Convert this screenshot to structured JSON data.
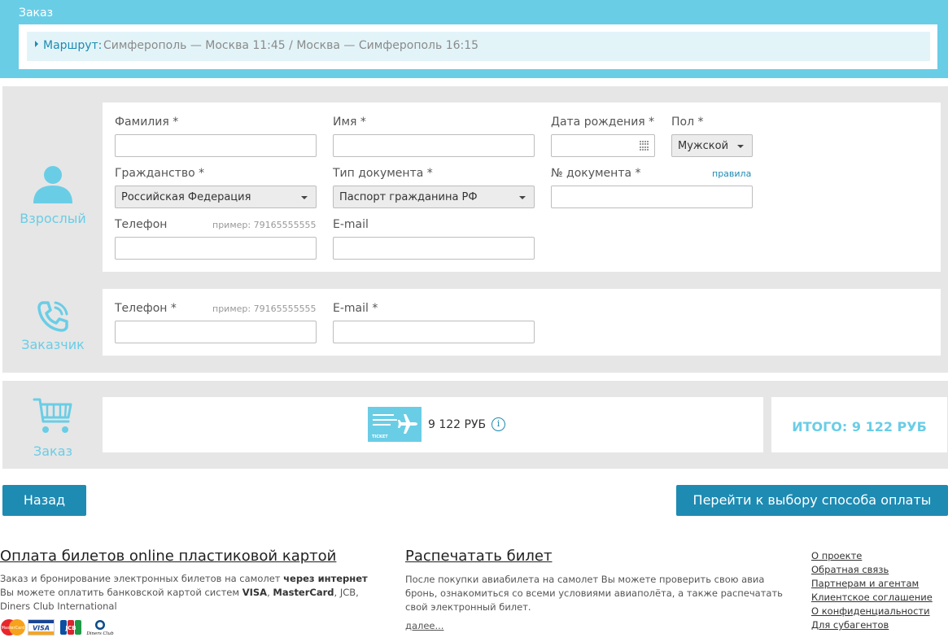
{
  "order_header": {
    "title": "Заказ",
    "route_label": "Маршрут:",
    "route_value": "Симферополь — Москва 11:45 / Москва — Симферополь 16:15"
  },
  "adult": {
    "side_label": "Взрослый",
    "fields": {
      "last_name": {
        "label": "Фамилия *",
        "value": ""
      },
      "first_name": {
        "label": "Имя *",
        "value": ""
      },
      "birth_date": {
        "label": "Дата рождения *",
        "value": ""
      },
      "gender": {
        "label": "Пол *",
        "value": "Мужской"
      },
      "citizenship": {
        "label": "Гражданство *",
        "value": "Российская Федерация"
      },
      "doc_type": {
        "label": "Тип документа *",
        "value": "Паспорт гражданина РФ"
      },
      "doc_number": {
        "label": "№ документа *",
        "value": "",
        "rules_link": "правила"
      },
      "phone": {
        "label": "Телефон",
        "hint": "пример: 79165555555",
        "value": ""
      },
      "email": {
        "label": "E-mail",
        "value": ""
      }
    }
  },
  "customer": {
    "side_label": "Заказчик",
    "fields": {
      "phone": {
        "label": "Телефон *",
        "hint": "пример: 79165555555",
        "value": ""
      },
      "email": {
        "label": "E-mail *",
        "value": ""
      }
    }
  },
  "order": {
    "side_label": "Заказ",
    "ticket_text": "TICKET",
    "ticket_price": "9 122 РУБ",
    "total": "ИТОГО: 9 122 РУБ"
  },
  "buttons": {
    "back": "Назад",
    "pay": "Перейти к выбору способа оплаты"
  },
  "footer": {
    "payment": {
      "title": "Оплата билетов online пластиковой картой",
      "text_1": "Заказ и бронирование электронных билетов на самолет ",
      "text_bold_1": "через интернет",
      "text_2": " Вы можете оплатить банковской картой систем ",
      "text_bold_2": "VISA",
      "text_3": ", ",
      "text_bold_3": "MasterCard",
      "text_4": ", JCB, Diners Club International"
    },
    "print": {
      "title": "Распечатать билет",
      "text": "После покупки авиабилета на самолет Вы можете проверить свою авиа бронь, ознакомиться со всеми условиями авиаполёта, а также распечатать свой электронный билет.",
      "more": "далее..."
    },
    "links": [
      "О проекте",
      "Обратная связь",
      "Партнерам и агентам",
      "Клиентское соглашение",
      "О конфиденциальности",
      "Для субагентов"
    ],
    "logos": {
      "mastercard": "MasterCard",
      "visa": "VISA",
      "jcb": "JCB",
      "diners": "Diners Club"
    }
  },
  "colors": {
    "accent": "#6acde6",
    "primary": "#1e8bb3",
    "panel": "#e6e6e6"
  }
}
